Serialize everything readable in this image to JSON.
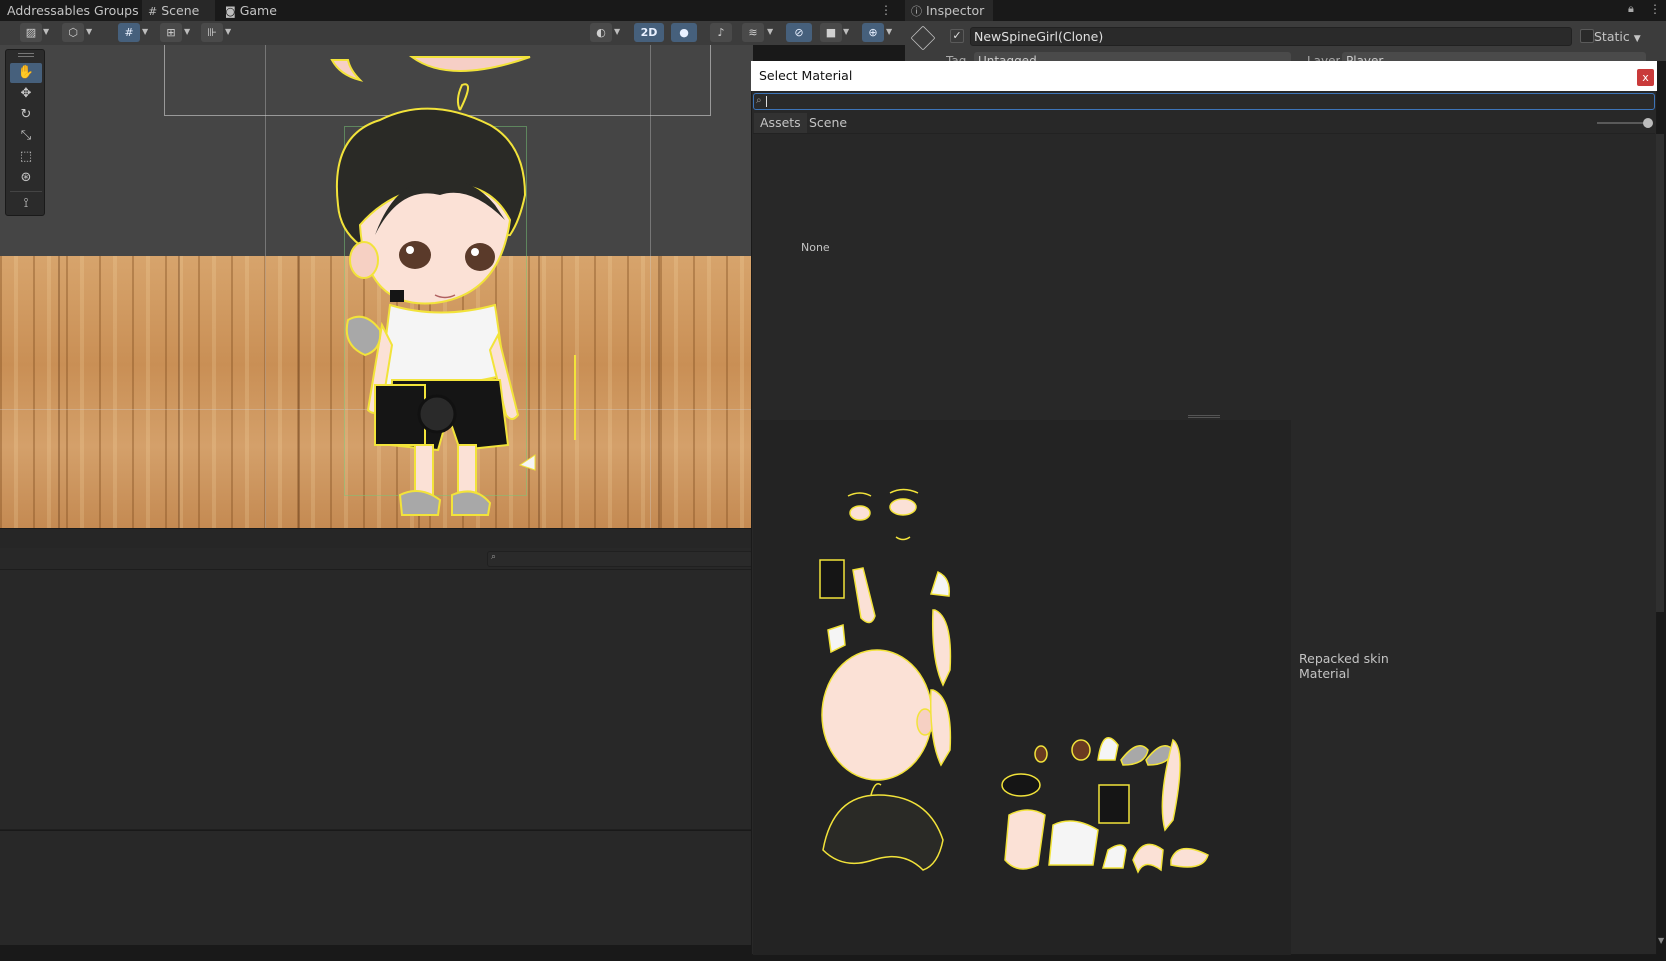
{
  "tabs": {
    "addressables": "Addressables Groups",
    "scene": "Scene",
    "game": "Game",
    "inspector": "Inspector"
  },
  "scene_toolbar": {
    "mode_2d": "2D"
  },
  "inspector": {
    "object_name": "NewSpineGirl(Clone)",
    "static_label": "Static",
    "tag_label": "Tag",
    "tag_value": "Untagged",
    "layer_label": "Layer",
    "layer_value": "Player"
  },
  "dialog": {
    "title": "Select Material",
    "close": "x",
    "search_value": "",
    "tab_assets": "Assets",
    "tab_scene": "Scene",
    "none_item": "None",
    "preview_label": "Repacked skin Material"
  },
  "colors": {
    "accent_blue": "#46607c",
    "close_red": "#c93a3a",
    "outline_yellow": "#f2e33a"
  }
}
